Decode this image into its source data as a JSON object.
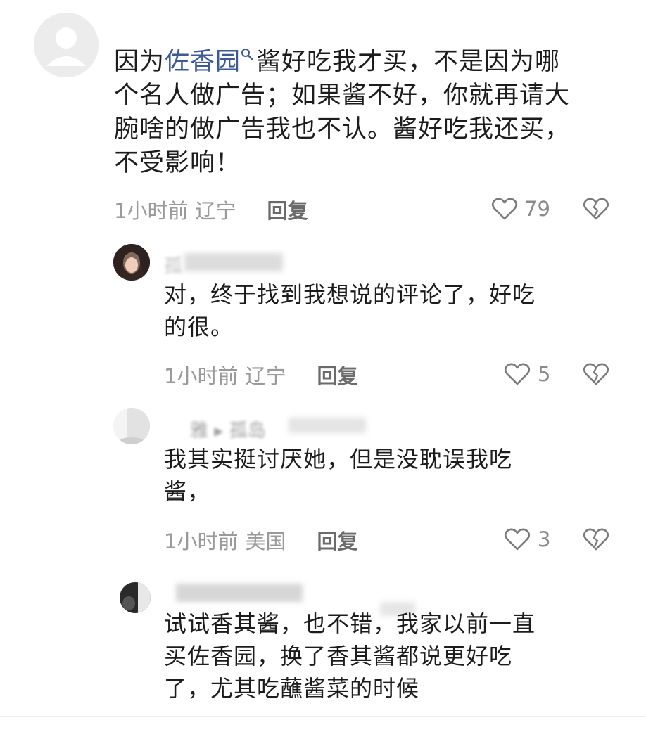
{
  "comments": [
    {
      "text_link": "佐香园",
      "text_pre": "因为",
      "text_line1_rest": "酱好吃我才买，不是因为哪",
      "text_line2": "个名人做广告；如果酱不好，你就再请大",
      "text_line3": "腕啥的做广告我也不认。酱好吃我还买，",
      "text_line4": "不受影响！",
      "time": "1小时前",
      "location": "辽宁",
      "reply_label": "回复",
      "likes": "79"
    }
  ],
  "replies": [
    {
      "author": "孤",
      "line1": "对，终于找到我想说的评论了，好吃",
      "line2": "的很。",
      "time": "1小时前",
      "location": "辽宁",
      "reply_label": "回复",
      "likes": "5"
    },
    {
      "author": "雅 ▸ 孤岛",
      "line1": "我其实挺讨厌她，但是没耽误我吃",
      "line2": "酱，",
      "time": "1小时前",
      "location": "美国",
      "reply_label": "回复",
      "likes": "3"
    },
    {
      "author": "",
      "line1": "试试香其酱，也不错，我家以前一直",
      "line2": "买佐香园，换了香其酱都说更好吃",
      "line3": "了，尤其吃蘸酱菜的时候"
    }
  ],
  "icons": {
    "like": "heart-outline-icon",
    "dislike": "broken-heart-icon",
    "search": "search-icon"
  },
  "colors": {
    "link": "#3d5a98",
    "meta": "#9a9a9a",
    "icon": "#7a7a7a"
  }
}
